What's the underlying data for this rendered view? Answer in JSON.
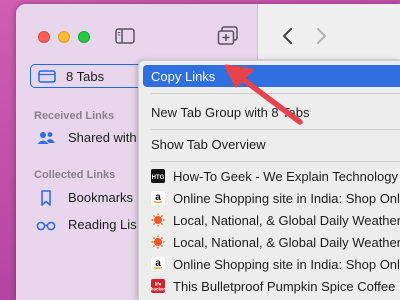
{
  "sidebar": {
    "tabs_row": {
      "label": "8 Tabs"
    },
    "sections": [
      {
        "header": "Received Links",
        "items": [
          {
            "label": "Shared with",
            "icon": "people-icon"
          }
        ]
      },
      {
        "header": "Collected Links",
        "items": [
          {
            "label": "Bookmarks",
            "icon": "bookmark-icon"
          },
          {
            "label": "Reading Lis",
            "icon": "glasses-icon"
          }
        ]
      }
    ]
  },
  "context_menu": {
    "items": [
      {
        "label": "Copy Links",
        "highlighted": true
      },
      {
        "label": "New Tab Group with 8 Tabs"
      },
      {
        "label": "Show Tab Overview"
      }
    ],
    "tabs": [
      {
        "label": "How-To Geek - We Explain Technology",
        "icon": "htg-favicon"
      },
      {
        "label": "Online Shopping site in India: Shop Onl",
        "icon": "amazon-favicon"
      },
      {
        "label": "Local, National, & Global Daily Weather",
        "icon": "weather-favicon"
      },
      {
        "label": "Local, National, & Global Daily Weather",
        "icon": "weather-favicon"
      },
      {
        "label": "Online Shopping site in India: Shop Onl",
        "icon": "amazon-favicon"
      },
      {
        "label": "This Bulletproof Pumpkin Spice Coffee",
        "icon": "lifehacker-favicon"
      }
    ]
  },
  "colors": {
    "accent": "#2f6fe1",
    "annotation_arrow": "#e8434c",
    "sidebar_bg": "#e7d6ec"
  }
}
